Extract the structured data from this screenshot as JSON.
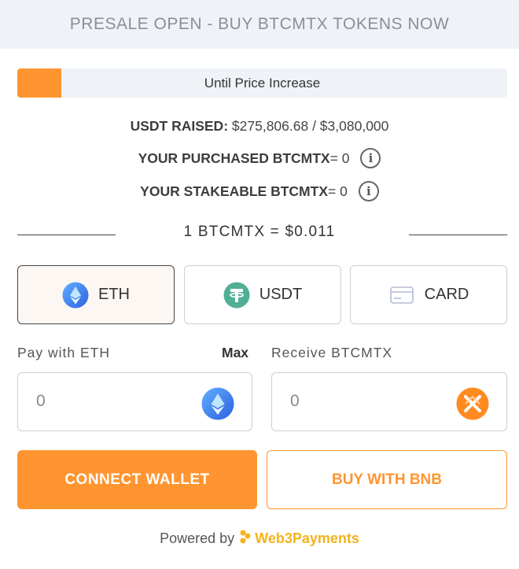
{
  "header": {
    "title": "PRESALE OPEN - BUY BTCMTX TOKENS NOW"
  },
  "progress": {
    "label": "Until Price Increase",
    "fill_fraction": 0.09
  },
  "stats": {
    "raised_label": "USDT RAISED:",
    "raised_value": "$275,806.68 / $3,080,000",
    "purchased_label": "YOUR PURCHASED BTCMTX",
    "purchased_value": "= 0",
    "stakeable_label": "YOUR STAKEABLE BTCMTX",
    "stakeable_value": "= 0",
    "info_icon": "info-icon"
  },
  "rate": {
    "text": "1 BTCMTX = $0.011"
  },
  "payment_tabs": [
    {
      "label": "ETH",
      "icon": "ethereum-icon",
      "selected": true
    },
    {
      "label": "USDT",
      "icon": "tether-icon",
      "selected": false
    },
    {
      "label": "CARD",
      "icon": "credit-card-icon",
      "selected": false
    }
  ],
  "pay": {
    "label": "Pay with ETH",
    "max_label": "Max",
    "value": "0",
    "icon": "ethereum-icon"
  },
  "receive": {
    "label": "Receive BTCMTX",
    "value": "0",
    "icon": "btcmtx-icon"
  },
  "buttons": {
    "connect_label": "CONNECT WALLET",
    "bnb_label": "BUY WITH BNB"
  },
  "footer": {
    "powered_label": "Powered by",
    "brand": "Web3Payments"
  },
  "colors": {
    "accent": "#ff9530",
    "eth_blue": "#3d8bf2",
    "usdt_green": "#50af95",
    "brand_yellow": "#f5b21a"
  }
}
